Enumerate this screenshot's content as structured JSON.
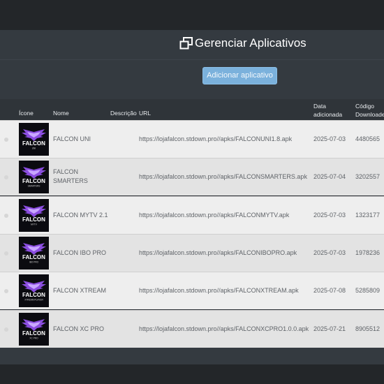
{
  "header": {
    "title": "Gerenciar Aplicativos",
    "add_button_label": "Adicionar aplicativo"
  },
  "table": {
    "columns": {
      "icon": "Ícone",
      "name": "Nome",
      "description": "Descrição",
      "url": "URL",
      "date_line1": "Data",
      "date_line2": "adicionada",
      "code_line1": "Código",
      "code_line2": "Downloader"
    },
    "rows": [
      {
        "name_l1": "FALCON UNI",
        "name_l2": "",
        "icon_subtitle": "UNI",
        "url": "https://lojafalcon.stdown.pro//apks/FALCONUNI1.8.apk",
        "date": "2025-07-03",
        "code": "4480565"
      },
      {
        "name_l1": "FALCON",
        "name_l2": "SMARTERS",
        "icon_subtitle": "SMARTERS",
        "url": "https://lojafalcon.stdown.pro//apks/FALCONSMARTERS.apk",
        "date": "2025-07-04",
        "code": "3202557"
      },
      {
        "name_l1": "FALCON MYTV 2.1",
        "name_l2": "",
        "icon_subtitle": "MYTV",
        "url": "https://lojafalcon.stdown.pro//apks/FALCONMYTV.apk",
        "date": "2025-07-03",
        "code": "1323177"
      },
      {
        "name_l1": "FALCON IBO PRO",
        "name_l2": "",
        "icon_subtitle": "IBO PRO",
        "url": "https://lojafalcon.stdown.pro//apks/FALCONIBOPRO.apk",
        "date": "2025-07-03",
        "code": "1978236"
      },
      {
        "name_l1": "FALCON XTREAM",
        "name_l2": "",
        "icon_subtitle": "XTREAM PLAYER",
        "url": "https://lojafalcon.stdown.pro//apks/FALCONXTREAM.apk",
        "date": "2025-07-08",
        "code": "5285809"
      },
      {
        "name_l1": "FALCON XC PRO",
        "name_l2": "",
        "icon_subtitle": "XC PRO",
        "url": "https://lojafalcon.stdown.pro//apks/FALCONXCPRO1.0.0.apk",
        "date": "2025-07-21",
        "code": "8905512"
      }
    ]
  },
  "icons": {
    "title_icon": "window-restore-icon",
    "app_icon": "falcon-logo-icon",
    "logo_word": "FALCON"
  },
  "colors": {
    "header_bg": "#343a40",
    "button_bg": "#7bb1dc",
    "row_bg": "#eeeeee",
    "row_alt_bg": "#e3e3e3",
    "logo_purple": "#8b4de0"
  }
}
